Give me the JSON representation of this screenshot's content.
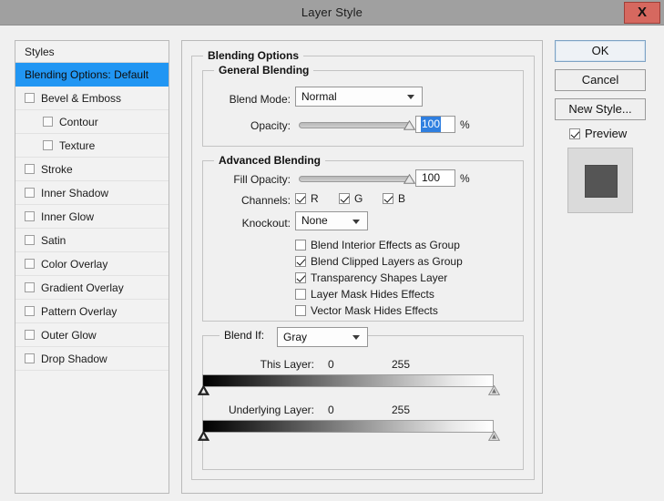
{
  "window": {
    "title": "Layer Style",
    "close_label": "X"
  },
  "styles_panel": {
    "header": "Styles",
    "items": [
      {
        "label": "Blending Options: Default",
        "selected": true,
        "checkbox": false,
        "indent": false
      },
      {
        "label": "Bevel & Emboss",
        "selected": false,
        "checkbox": true,
        "checked": false,
        "indent": false
      },
      {
        "label": "Contour",
        "selected": false,
        "checkbox": true,
        "checked": false,
        "indent": true
      },
      {
        "label": "Texture",
        "selected": false,
        "checkbox": true,
        "checked": false,
        "indent": true
      },
      {
        "label": "Stroke",
        "selected": false,
        "checkbox": true,
        "checked": false,
        "indent": false
      },
      {
        "label": "Inner Shadow",
        "selected": false,
        "checkbox": true,
        "checked": false,
        "indent": false
      },
      {
        "label": "Inner Glow",
        "selected": false,
        "checkbox": true,
        "checked": false,
        "indent": false
      },
      {
        "label": "Satin",
        "selected": false,
        "checkbox": true,
        "checked": false,
        "indent": false
      },
      {
        "label": "Color Overlay",
        "selected": false,
        "checkbox": true,
        "checked": false,
        "indent": false
      },
      {
        "label": "Gradient Overlay",
        "selected": false,
        "checkbox": true,
        "checked": false,
        "indent": false
      },
      {
        "label": "Pattern Overlay",
        "selected": false,
        "checkbox": true,
        "checked": false,
        "indent": false
      },
      {
        "label": "Outer Glow",
        "selected": false,
        "checkbox": true,
        "checked": false,
        "indent": false
      },
      {
        "label": "Drop Shadow",
        "selected": false,
        "checkbox": true,
        "checked": false,
        "indent": false
      }
    ]
  },
  "blending_options": {
    "title": "Blending Options",
    "general_blending": {
      "title": "General Blending",
      "blend_mode_label": "Blend Mode:",
      "blend_mode_value": "Normal",
      "opacity_label": "Opacity:",
      "opacity_value": "100",
      "opacity_unit": "%",
      "opacity_slider_percent": 100
    },
    "advanced_blending": {
      "title": "Advanced Blending",
      "fill_opacity_label": "Fill Opacity:",
      "fill_opacity_value": "100",
      "fill_opacity_unit": "%",
      "fill_opacity_slider_percent": 100,
      "channels_label": "Channels:",
      "channels": [
        {
          "label": "R",
          "checked": true
        },
        {
          "label": "G",
          "checked": true
        },
        {
          "label": "B",
          "checked": true
        }
      ],
      "knockout_label": "Knockout:",
      "knockout_value": "None",
      "options": [
        {
          "label": "Blend Interior Effects as Group",
          "checked": false
        },
        {
          "label": "Blend Clipped Layers as Group",
          "checked": true
        },
        {
          "label": "Transparency Shapes Layer",
          "checked": true
        },
        {
          "label": "Layer Mask Hides Effects",
          "checked": false
        },
        {
          "label": "Vector Mask Hides Effects",
          "checked": false
        }
      ]
    },
    "blend_if": {
      "label": "Blend If:",
      "value": "Gray",
      "this_layer": {
        "label": "This Layer:",
        "min": "0",
        "max": "255"
      },
      "underlying_layer": {
        "label": "Underlying Layer:",
        "min": "0",
        "max": "255"
      }
    }
  },
  "actions": {
    "ok": "OK",
    "cancel": "Cancel",
    "new_style": "New Style...",
    "preview_label": "Preview",
    "preview_checked": true
  },
  "colors": {
    "selection_blue": "#2196f3",
    "titlebar": "#a0a0a0",
    "close_red": "#d6685f",
    "dialog_bg": "#f0f0f0",
    "preview_square": "#555555"
  }
}
